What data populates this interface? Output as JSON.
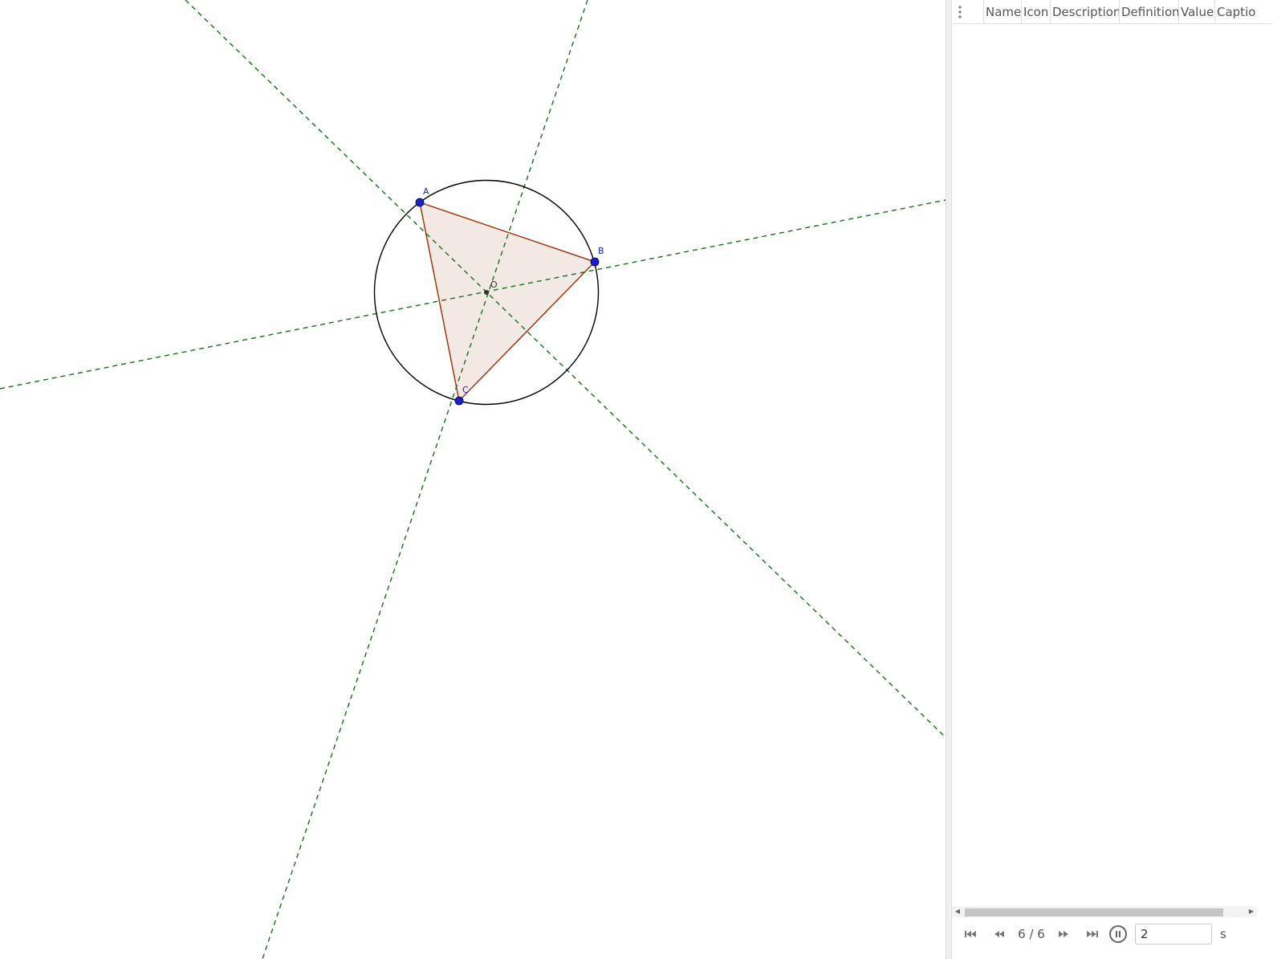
{
  "graphics": {
    "points": [
      {
        "id": "A",
        "label": "A"
      },
      {
        "id": "B",
        "label": "B"
      },
      {
        "id": "C",
        "label": "C"
      },
      {
        "id": "O",
        "label": "O"
      }
    ],
    "colors": {
      "point": "#1a1adb",
      "label": "#1a1acc",
      "center": "#333333",
      "circle": "#000000",
      "triangle_stroke": "#a0390f",
      "triangle_fill": "#f3e9e4",
      "bisector": "#1a6e1a"
    }
  },
  "construction_protocol": {
    "menu_icon": "vertical-dots-icon",
    "columns": [
      "Name",
      "Icon",
      "Description",
      "Definition",
      "Value",
      "Captio"
    ]
  },
  "navigation": {
    "first_icon": "skip-to-start-icon",
    "prev_icon": "rewind-icon",
    "step": "6 / 6",
    "next_icon": "fast-forward-icon",
    "last_icon": "skip-to-end-icon",
    "play_icon": "pause-icon",
    "speed_value": "2",
    "speed_unit": "s"
  }
}
